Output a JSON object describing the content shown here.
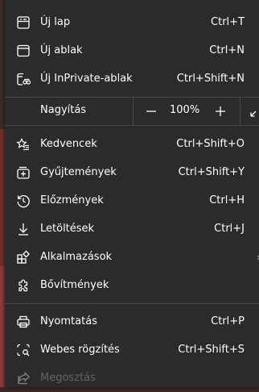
{
  "menu": {
    "items_top": [
      {
        "icon": "new-tab-icon",
        "label": "Új lap",
        "shortcut": "Ctrl+T"
      },
      {
        "icon": "new-window-icon",
        "label": "Új ablak",
        "shortcut": "Ctrl+N"
      },
      {
        "icon": "inprivate-window-icon",
        "label": "Új InPrivate-ablak",
        "shortcut": "Ctrl+Shift+N"
      }
    ],
    "zoom": {
      "label": "Nagyítás",
      "value": "100%",
      "minus": "—",
      "plus": "+"
    },
    "items_mid": [
      {
        "icon": "favorites-icon",
        "label": "Kedvencek",
        "shortcut": "Ctrl+Shift+O"
      },
      {
        "icon": "collections-icon",
        "label": "Gyűjtemények",
        "shortcut": "Ctrl+Shift+Y"
      },
      {
        "icon": "history-icon",
        "label": "Előzmények",
        "shortcut": "Ctrl+H"
      },
      {
        "icon": "downloads-icon",
        "label": "Letöltések",
        "shortcut": "Ctrl+J"
      },
      {
        "icon": "apps-icon",
        "label": "Alkalmazások",
        "shortcut": ""
      },
      {
        "icon": "extensions-icon",
        "label": "Bővítmények",
        "shortcut": ""
      }
    ],
    "items_bottom": [
      {
        "icon": "print-icon",
        "label": "Nyomtatás",
        "shortcut": "Ctrl+P"
      },
      {
        "icon": "web-capture-icon",
        "label": "Webes rögzítés",
        "shortcut": "Ctrl+Shift+S"
      },
      {
        "icon": "share-icon",
        "label": "Megosztás",
        "shortcut": ""
      }
    ]
  },
  "colors": {
    "menu_bg": "#2b2b2b",
    "divider": "#474747",
    "text": "#ffffff",
    "disabled_text": "#8a8a8a"
  }
}
